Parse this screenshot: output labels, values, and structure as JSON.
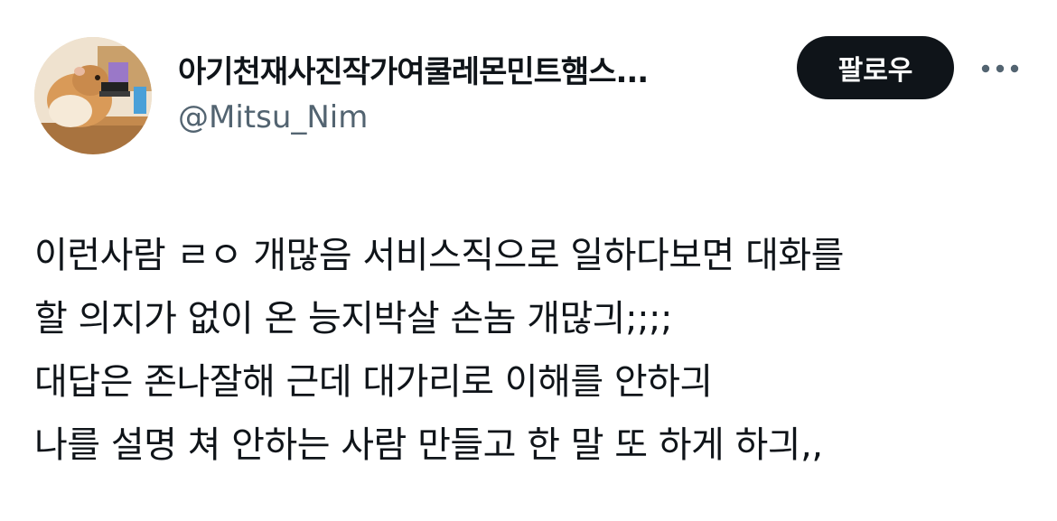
{
  "author": {
    "display_name": "아기천재사진작가여쿨레몬민트햄스...",
    "handle": "@Mitsu_Nim",
    "avatar_icon": "hamster-photo-avatar"
  },
  "actions": {
    "follow_label": "팔로우",
    "more_icon": "more-horizontal-icon"
  },
  "tweet": {
    "lines": [
      "이런사람 ㄹㅇ 개많음 서비스직으로 일하다보면 대화를",
      "할 의지가 없이 온 능지박살 손놈 개많긔;;;;",
      "대답은 존나잘해 근데 대가리로 이해를 안하긔",
      "나를 설명 쳐 안하는 사람 만들고 한 말 또 하게 하긔,,"
    ]
  },
  "colors": {
    "text_primary": "#0f1419",
    "text_secondary": "#536471",
    "follow_bg": "#0f1419",
    "follow_text": "#ffffff"
  }
}
